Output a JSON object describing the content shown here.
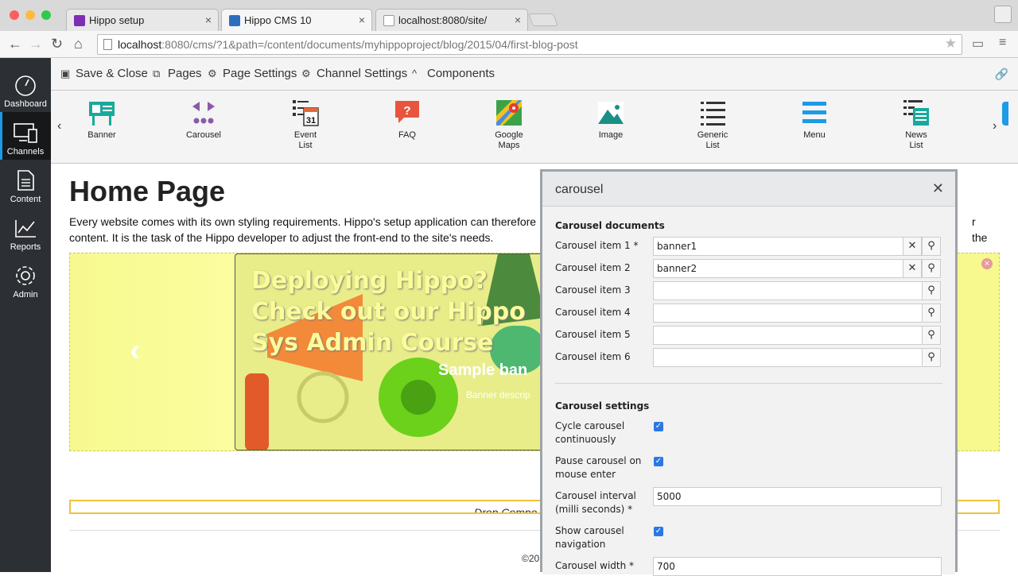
{
  "browser": {
    "tabs": [
      {
        "title": "Hippo setup",
        "favicon_color": "#7b2fb5"
      },
      {
        "title": "Hippo CMS 10",
        "favicon_color": "#2d6fbf"
      },
      {
        "title": "localhost:8080/site/",
        "favicon_color": "#ffffff"
      }
    ],
    "url_host": "localhost",
    "url_rest": ":8080/cms/?1&path=/content/documents/myhippoproject/blog/2015/04/first-blog-post"
  },
  "sidebar": {
    "items": [
      {
        "label": "Dashboard",
        "icon": "dashboard-icon"
      },
      {
        "label": "Channels",
        "icon": "channels-icon"
      },
      {
        "label": "Content",
        "icon": "content-icon"
      },
      {
        "label": "Reports",
        "icon": "reports-icon"
      },
      {
        "label": "Admin",
        "icon": "gear-icon"
      }
    ]
  },
  "cms_toolbar": {
    "save_close": "Save & Close",
    "pages": "Pages",
    "page_settings": "Page Settings",
    "channel_settings": "Channel Settings",
    "components": "Components"
  },
  "components": [
    {
      "label": "Banner",
      "icon": "banner-icon"
    },
    {
      "label": "Carousel",
      "icon": "carousel-icon"
    },
    {
      "label": "Event",
      "label2": "List",
      "icon": "calendar-icon"
    },
    {
      "label": "FAQ",
      "icon": "faq-icon"
    },
    {
      "label": "Google",
      "label2": "Maps",
      "icon": "map-icon"
    },
    {
      "label": "Image",
      "icon": "image-icon"
    },
    {
      "label": "Generic",
      "label2": "List",
      "icon": "list-icon"
    },
    {
      "label": "Menu",
      "icon": "menu-icon"
    },
    {
      "label": "News",
      "label2": "List",
      "icon": "news-icon"
    }
  ],
  "page": {
    "title": "Home Page",
    "intro_line1": "Every website comes with its own styling requirements. Hippo's setup application can therefore",
    "intro_line1_tail": "r the",
    "intro_line2": "content. It is the task of the Hippo developer to adjust the front-end to the site's needs.",
    "banner_headline_1": "Deploying Hippo?",
    "banner_headline_2": "Check out our Hippo",
    "banner_headline_3": "Sys Admin Course",
    "banner_sample": "Sample ban",
    "banner_desc": "Banner descrip",
    "drop_zone": "Drop Compo",
    "copyright": "©201"
  },
  "dialog": {
    "title": "carousel",
    "documents_section": "Carousel documents",
    "items": [
      {
        "label": "Carousel item 1 *",
        "value": "banner1"
      },
      {
        "label": "Carousel item 2",
        "value": "banner2"
      },
      {
        "label": "Carousel item 3",
        "value": ""
      },
      {
        "label": "Carousel item 4",
        "value": ""
      },
      {
        "label": "Carousel item 5",
        "value": ""
      },
      {
        "label": "Carousel item 6",
        "value": ""
      }
    ],
    "settings_section": "Carousel settings",
    "cycle_label_1": "Cycle carousel",
    "cycle_label_2": "continuously",
    "cycle_checked": true,
    "pause_label_1": "Pause carousel on",
    "pause_label_2": "mouse enter",
    "pause_checked": true,
    "interval_label_1": "Carousel interval",
    "interval_label_2": "(milli seconds) *",
    "interval_value": "5000",
    "nav_label_1": "Show carousel",
    "nav_label_2": "navigation",
    "nav_checked": true,
    "width_label": "Carousel width *",
    "width_value": "700"
  },
  "colors": {
    "sidebar_bg": "#2c2f33",
    "accent": "#1d9be6",
    "banner_bg": "#f7f98f",
    "checkbox": "#2b78e4"
  }
}
